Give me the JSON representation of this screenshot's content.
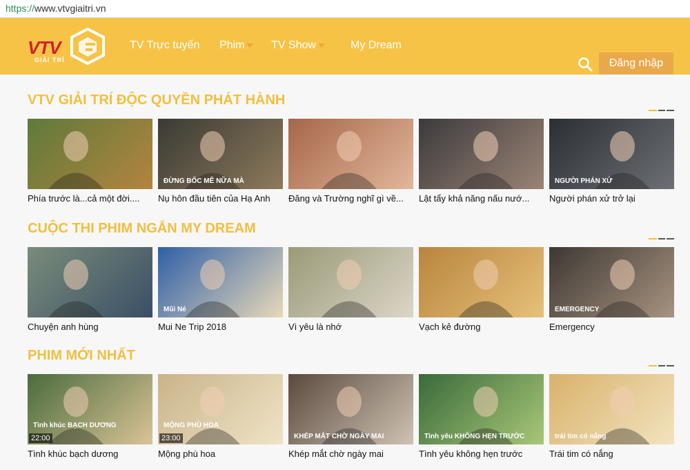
{
  "browser": {
    "url_scheme": "https://",
    "url_rest": "www.vtvgiaitri.vn"
  },
  "header": {
    "logo_text": "VTV",
    "logo_sub": "GIẢI TRÍ",
    "nav": [
      {
        "label": "TV Trực tuyến",
        "has_caret": false
      },
      {
        "label": "Phim",
        "has_caret": true
      },
      {
        "label": "TV Show",
        "has_caret": true
      },
      {
        "label": "My Dream",
        "has_caret": false
      }
    ],
    "login_label": "Đăng nhập",
    "search_icon": "search-icon",
    "bg_color": "#f6c347"
  },
  "sections": [
    {
      "title": "VTV GIẢI TRÍ ĐỘC QUYỀN PHÁT HÀNH",
      "items": [
        {
          "title": "Phía trước là...cả một đời....",
          "overlay": "",
          "time": ""
        },
        {
          "title": "Nụ hôn đầu tiên của Hạ Anh",
          "overlay": "ĐỪNG BỐC MẼ NỮA MÀ",
          "time": ""
        },
        {
          "title": "Đăng và Trường nghĩ gì về...",
          "overlay": "",
          "time": ""
        },
        {
          "title": "Lật tẩy khả năng nấu nướ...",
          "overlay": "",
          "time": ""
        },
        {
          "title": "Người phán xử trở lại",
          "overlay": "NGƯỜI PHÁN XỬ",
          "time": ""
        }
      ]
    },
    {
      "title": "CUỘC THI PHIM NGẮN MY DREAM",
      "items": [
        {
          "title": "Chuyện anh hùng",
          "overlay": "",
          "time": ""
        },
        {
          "title": "Mui Ne Trip 2018",
          "overlay": "Mũi Né",
          "time": ""
        },
        {
          "title": "Vì yêu là nhớ",
          "overlay": "",
          "time": ""
        },
        {
          "title": "Vạch kẻ đường",
          "overlay": "",
          "time": ""
        },
        {
          "title": "Emergency",
          "overlay": "EMERGENCY",
          "time": ""
        }
      ]
    },
    {
      "title": "PHIM MỚI NHẤT",
      "items": [
        {
          "title": "Tình khúc bạch dương",
          "overlay": "Tình khúc BẠCH DƯƠNG",
          "time": "22:00"
        },
        {
          "title": "Mộng phù hoa",
          "overlay": "MỘNG PHÙ HOA",
          "time": "23:00"
        },
        {
          "title": "Khép mắt chờ ngày mai",
          "overlay": "KHÉP MẮT CHỜ NGÀY MAI",
          "time": ""
        },
        {
          "title": "Tình yêu không hẹn trước",
          "overlay": "Tình yêu KHÔNG HẸN TRƯỚC",
          "time": ""
        },
        {
          "title": "Trái tim có nắng",
          "overlay": "trái tim có nắng",
          "time": ""
        }
      ]
    }
  ],
  "thumb_palettes": [
    [
      "#5f7a3a",
      "#b3843f"
    ],
    [
      "#3a3a34",
      "#8d7a5c"
    ],
    [
      "#a6664a",
      "#e2b79a"
    ],
    [
      "#3c3a3c",
      "#9a8476"
    ],
    [
      "#2b2f33",
      "#6c7075"
    ],
    [
      "#7a8c7a",
      "#3a4f66"
    ],
    [
      "#2f5fa8",
      "#e8d9b8"
    ],
    [
      "#9a9a78",
      "#dcd6c7"
    ],
    [
      "#b9853e",
      "#e6c07a"
    ],
    [
      "#3d3833",
      "#a79380"
    ],
    [
      "#4b6b3c",
      "#d9c497"
    ],
    [
      "#c9b48a",
      "#efe3c6"
    ],
    [
      "#5a4a3e",
      "#cfc3b3"
    ],
    [
      "#3a6a3a",
      "#a8c878"
    ],
    [
      "#d9b26b",
      "#f2e3bf"
    ]
  ],
  "accent_color": "#f2bf3f"
}
